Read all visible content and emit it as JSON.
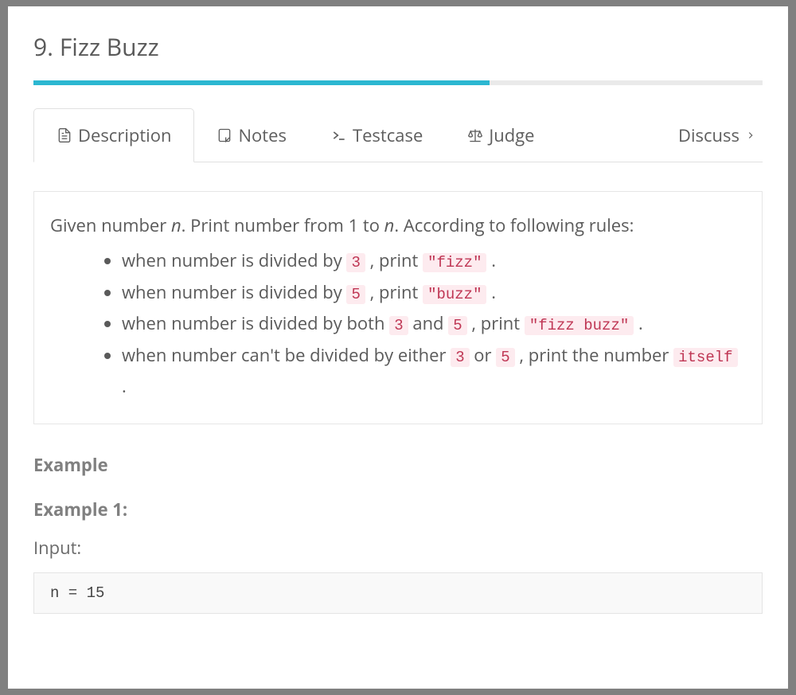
{
  "title": "9. Fizz Buzz",
  "progress_percent": 62.5,
  "tabs": {
    "description": "Description",
    "notes": "Notes",
    "testcase": "Testcase",
    "judge": "Judge",
    "discuss": "Discuss"
  },
  "description": {
    "intro_prefix": "Given number ",
    "intro_n": "n",
    "intro_mid": ". Print number from 1 to ",
    "intro_suffix": ". According to following rules:",
    "rule1_prefix": "when number is divided by ",
    "rule1_code1": "3",
    "rule1_mid": " , print ",
    "rule1_code2": "\"fizz\"",
    "rule1_suffix": " .",
    "rule2_prefix": "when number is divided by ",
    "rule2_code1": "5",
    "rule2_mid": " , print ",
    "rule2_code2": "\"buzz\"",
    "rule2_suffix": " .",
    "rule3_prefix": "when number is divided by both ",
    "rule3_code1": "3",
    "rule3_mid1": " and ",
    "rule3_code2": "5",
    "rule3_mid2": " , print ",
    "rule3_code3": "\"fizz buzz\"",
    "rule3_suffix": " .",
    "rule4_prefix": "when number can't be divided by either ",
    "rule4_code1": "3",
    "rule4_mid1": " or ",
    "rule4_code2": "5",
    "rule4_mid2": " , print the number ",
    "rule4_code3": "itself",
    "rule4_suffix": " ."
  },
  "example": {
    "heading": "Example",
    "ex1": "Example 1:",
    "input_label": "Input:",
    "input_code": "n = 15"
  }
}
